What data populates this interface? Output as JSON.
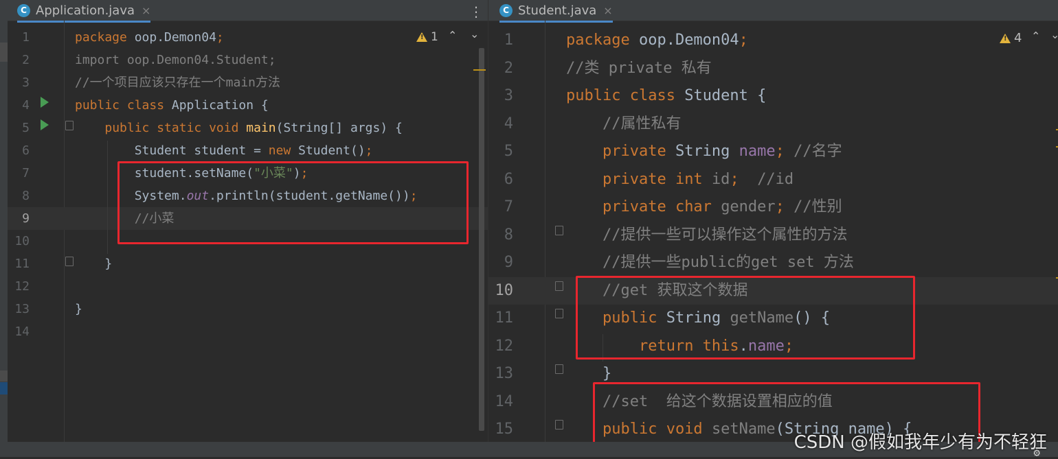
{
  "left_editor": {
    "tab": {
      "icon": "java-class-icon",
      "icon_letter": "C",
      "label": "Application.java",
      "close": "×"
    },
    "menu": "⋮",
    "inspection": {
      "count": "1"
    },
    "lines": [
      {
        "n": "1",
        "html": "<span class='kw'>package</span> oop.Demon04<span class='kw'>;</span>"
      },
      {
        "n": "2",
        "html": "<span class='gray'>import oop.Demon04.Student;</span>"
      },
      {
        "n": "3",
        "html": "<span class='cm'>//一个项目应该只存在一个main方法</span>"
      },
      {
        "n": "4",
        "html": "<span class='kw'>public class</span> Application {"
      },
      {
        "n": "5",
        "html": "    <span class='kw'>public static void</span> <span class='fn'>main</span>(String[] args) {"
      },
      {
        "n": "6",
        "html": "        Student student = <span class='kw'>new</span> Student()<span class='kw'>;</span>"
      },
      {
        "n": "7",
        "html": "        student.setName(<span class='str'>\"小菜\"</span>)<span class='kw'>;</span>"
      },
      {
        "n": "8",
        "html": "        System.<span class='st'>out</span>.println(student.getName())<span class='kw'>;</span>"
      },
      {
        "n": "9",
        "html": "        <span class='cm'>//小菜</span>"
      },
      {
        "n": "10",
        "html": ""
      },
      {
        "n": "11",
        "html": "    }"
      },
      {
        "n": "12",
        "html": ""
      },
      {
        "n": "13",
        "html": "}"
      },
      {
        "n": "14",
        "html": ""
      }
    ]
  },
  "right_editor": {
    "tab": {
      "icon": "java-class-icon",
      "icon_letter": "C",
      "label": "Student.java",
      "close": "×"
    },
    "inspection": {
      "count": "4"
    },
    "lines": [
      {
        "n": "1",
        "html": "<span class='kw'>package</span> oop.Demon04<span class='kw'>;</span>"
      },
      {
        "n": "2",
        "html": "<span class='cm'>//类 private 私有</span>"
      },
      {
        "n": "3",
        "html": "<span class='kw'>public class</span> Student {"
      },
      {
        "n": "4",
        "html": "    <span class='cm'>//属性私有</span>"
      },
      {
        "n": "5",
        "html": "    <span class='kw'>private</span> String <span class='fld'>name</span><span class='kw'>;</span> <span class='cm'>//名字</span>"
      },
      {
        "n": "6",
        "html": "    <span class='kw'>private int</span> <span class='gray'>id</span><span class='kw'>;</span>  <span class='cm'>//id</span>"
      },
      {
        "n": "7",
        "html": "    <span class='kw'>private char</span> <span class='gray'>gender</span><span class='kw'>;</span> <span class='cm'>//性别</span>"
      },
      {
        "n": "8",
        "html": "    <span class='cm'>//提供一些可以操作这个属性的方法</span>"
      },
      {
        "n": "9",
        "html": "    <span class='cm'>//提供一些public的get set 方法</span>"
      },
      {
        "n": "10",
        "html": "    <span class='cm'>//get 获取这个数据</span>"
      },
      {
        "n": "11",
        "html": "    <span class='kw'>public</span> String <span class='gray'>getName</span>() {"
      },
      {
        "n": "12",
        "html": "        <span class='kw'>return this</span>.<span class='fld'>name</span><span class='kw'>;</span>"
      },
      {
        "n": "13",
        "html": "    }"
      },
      {
        "n": "14",
        "html": "    <span class='cm'>//set  给这个数据设置相应的值</span>"
      },
      {
        "n": "15",
        "html": "    <span class='kw'>public void</span> <span class='gray'>setName</span>(String name) {"
      }
    ]
  },
  "watermark": "CSDN @假如我年少有为不轻狂",
  "colors": {
    "keyword": "#cc7832",
    "string": "#6a8759",
    "comment": "#808080",
    "field": "#9876aa",
    "method": "#ffc66d",
    "highlight_box": "#e8262e"
  }
}
